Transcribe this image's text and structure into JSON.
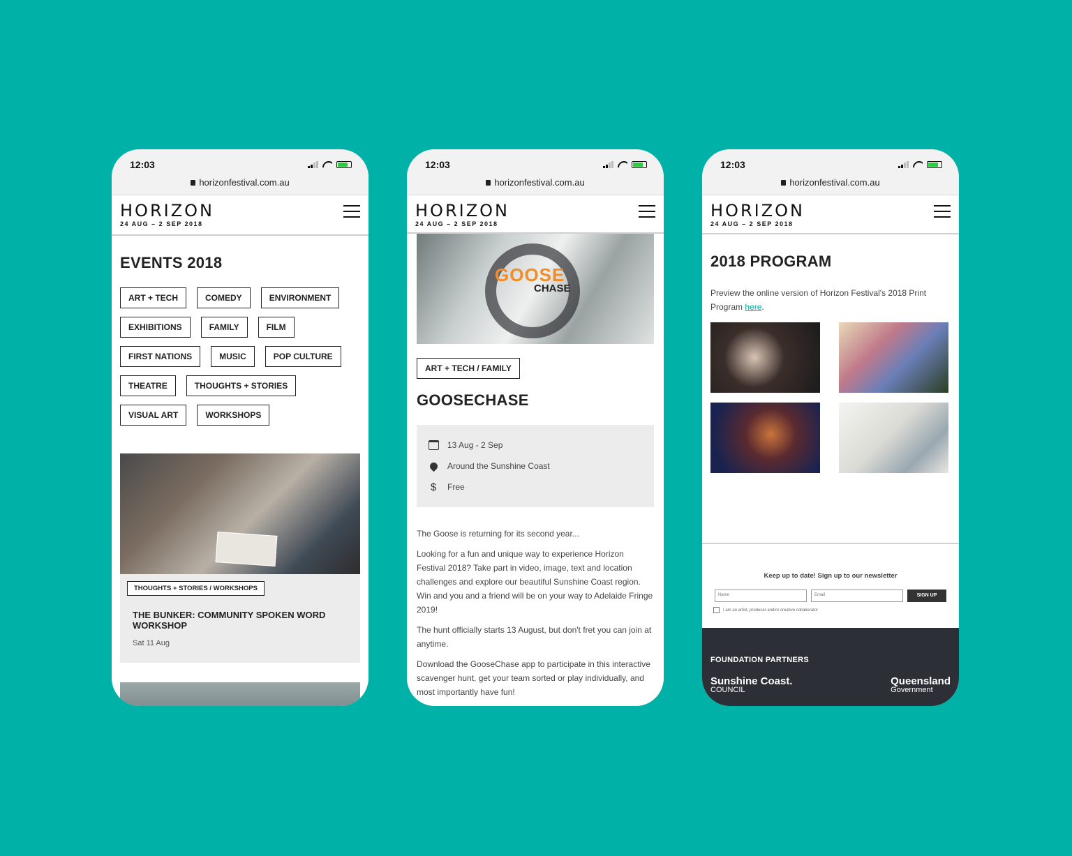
{
  "status": {
    "time": "12:03",
    "url": "horizonfestival.com.au"
  },
  "brand": {
    "name": "HORIZON",
    "dates": "24 AUG – 2 SEP 2018"
  },
  "events_page": {
    "title": "EVENTS 2018",
    "tags": [
      "ART + TECH",
      "COMEDY",
      "ENVIRONMENT",
      "EXHIBITIONS",
      "FAMILY",
      "FILM",
      "FIRST NATIONS",
      "MUSIC",
      "POP CULTURE",
      "THEATRE",
      "THOUGHTS + STORIES",
      "VISUAL ART",
      "WORKSHOPS"
    ],
    "card": {
      "tag": "THOUGHTS + STORIES / WORKSHOPS",
      "title": "THE BUNKER: COMMUNITY SPOKEN WORD WORKSHOP",
      "date": "Sat 11 Aug"
    }
  },
  "event_detail": {
    "hero": {
      "word1": "GOOSE",
      "word2": "CHASE"
    },
    "tag": "ART + TECH / FAMILY",
    "title": "GOOSECHASE",
    "info": {
      "date": "13 Aug - 2 Sep",
      "location": "Around the Sunshine Coast",
      "price": "Free"
    },
    "paragraphs": [
      "The Goose is returning for its second year...",
      "Looking for a fun and unique way to experience Horizon Festival 2018? Take part in video, image, text and location challenges and explore our beautiful Sunshine Coast region. Win and you and a friend will be on your way to Adelaide Fringe 2019!",
      "The hunt officially starts 13 August, but don't fret you can join at anytime.",
      "Download the GooseChase app to participate in this interactive scavenger hunt, get your team sorted or play individually, and most importantly have fun!"
    ]
  },
  "program_page": {
    "title": "2018 PROGRAM",
    "desc": "Preview the online version of Horizon Festival's 2018 Print Program ",
    "link": "here",
    "desc_end": ".",
    "newsletter": {
      "title": "Keep up to date! Sign up to our newsletter",
      "name_placeholder": "Name",
      "email_placeholder": "Email",
      "button": "SIGN UP",
      "checkbox": "I am an artist, producer and/or creative collaborator"
    },
    "partners": {
      "title": "FOUNDATION PARTNERS",
      "logo1": "Sunshine Coast.",
      "logo1_sub": "COUNCIL",
      "logo2": "Queensland",
      "logo2_sub": "Government"
    }
  }
}
